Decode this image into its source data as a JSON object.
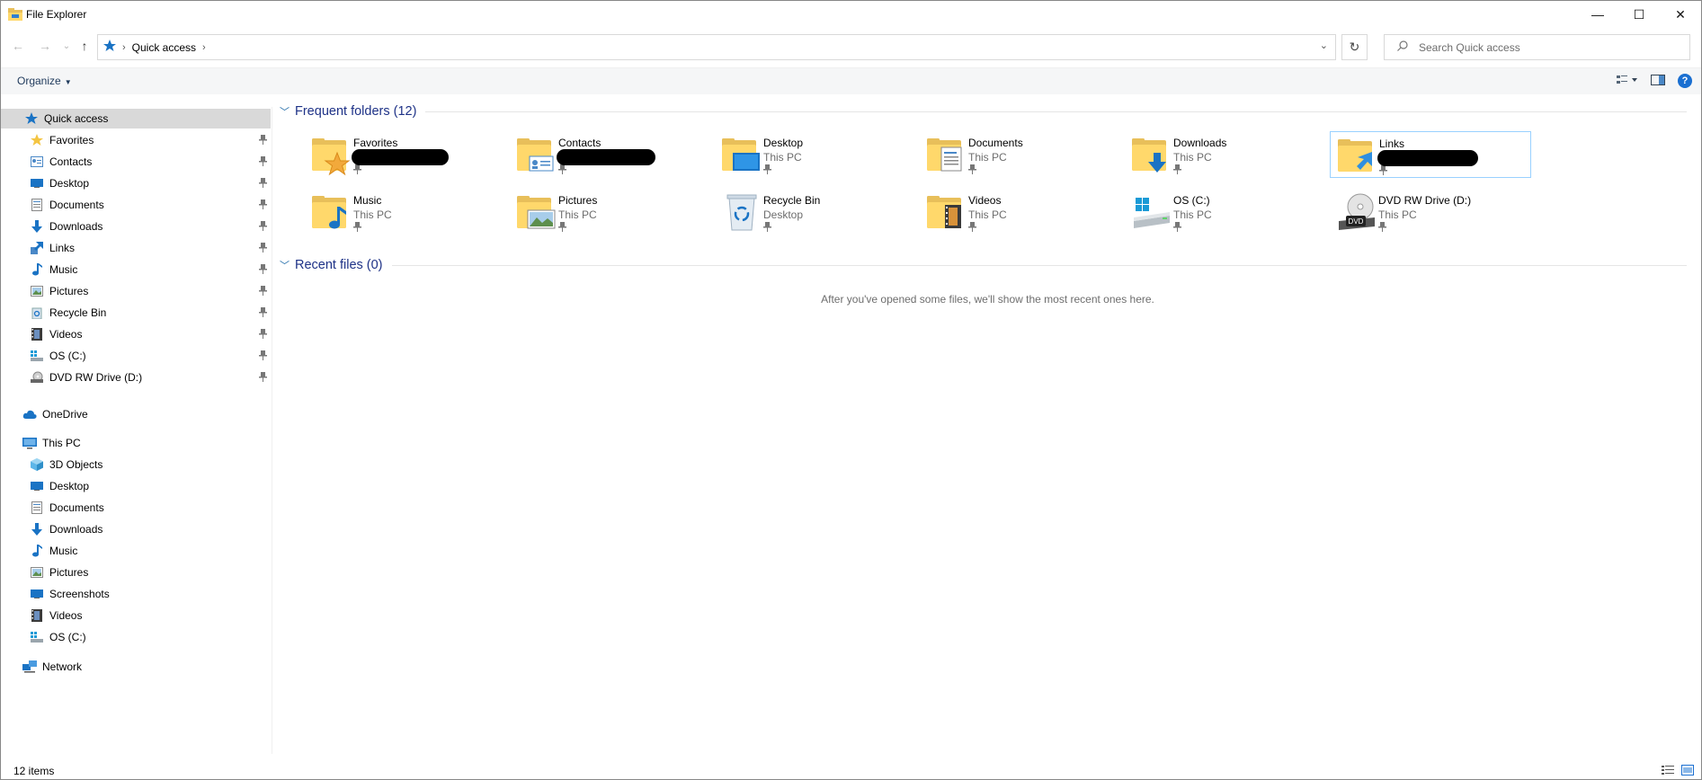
{
  "window": {
    "title": "File Explorer",
    "minimize": "—",
    "maximize": "☐",
    "close": "✕"
  },
  "nav": {
    "back": "←",
    "forward": "→",
    "recent": "⌄",
    "up": "↑"
  },
  "address": {
    "crumb": "Quick access",
    "sep": "›",
    "dropdown": "⌄",
    "refresh": "↻"
  },
  "search": {
    "placeholder": "Search Quick access"
  },
  "commandbar": {
    "organize": "Organize",
    "help": "?"
  },
  "sidebar": {
    "quick_access": "Quick access",
    "quick_items": [
      {
        "label": "Favorites",
        "icon": "star-icon"
      },
      {
        "label": "Contacts",
        "icon": "contacts-icon"
      },
      {
        "label": "Desktop",
        "icon": "desktop-icon"
      },
      {
        "label": "Documents",
        "icon": "documents-icon"
      },
      {
        "label": "Downloads",
        "icon": "downloads-icon"
      },
      {
        "label": "Links",
        "icon": "links-icon"
      },
      {
        "label": "Music",
        "icon": "music-icon"
      },
      {
        "label": "Pictures",
        "icon": "pictures-icon"
      },
      {
        "label": "Recycle Bin",
        "icon": "recycle-bin-icon"
      },
      {
        "label": "Videos",
        "icon": "videos-icon"
      },
      {
        "label": "OS (C:)",
        "icon": "drive-icon"
      },
      {
        "label": "DVD RW Drive (D:)",
        "icon": "dvd-drive-icon"
      }
    ],
    "onedrive": "OneDrive",
    "this_pc": "This PC",
    "pc_items": [
      {
        "label": "3D Objects",
        "icon": "3d-objects-icon"
      },
      {
        "label": "Desktop",
        "icon": "desktop-icon"
      },
      {
        "label": "Documents",
        "icon": "documents-icon"
      },
      {
        "label": "Downloads",
        "icon": "downloads-icon"
      },
      {
        "label": "Music",
        "icon": "music-icon"
      },
      {
        "label": "Pictures",
        "icon": "pictures-icon"
      },
      {
        "label": "Screenshots",
        "icon": "screenshots-icon"
      },
      {
        "label": "Videos",
        "icon": "videos-icon"
      },
      {
        "label": "OS (C:)",
        "icon": "drive-icon"
      }
    ],
    "network": "Network"
  },
  "main": {
    "frequent_title": "Frequent folders (12)",
    "recent_title": "Recent files (0)",
    "empty_message": "After you've opened some files, we'll show the most recent ones here.",
    "folders": [
      {
        "name": "Favorites",
        "location": "",
        "icon": "favorites-folder-icon",
        "redacted": true
      },
      {
        "name": "Contacts",
        "location": "",
        "icon": "contacts-folder-icon",
        "redacted": true
      },
      {
        "name": "Desktop",
        "location": "This PC",
        "icon": "desktop-folder-icon"
      },
      {
        "name": "Documents",
        "location": "This PC",
        "icon": "documents-folder-icon"
      },
      {
        "name": "Downloads",
        "location": "This PC",
        "icon": "downloads-folder-icon"
      },
      {
        "name": "Links",
        "location": "",
        "icon": "links-folder-icon",
        "redacted": true
      },
      {
        "name": "Music",
        "location": "This PC",
        "icon": "music-folder-icon"
      },
      {
        "name": "Pictures",
        "location": "This PC",
        "icon": "pictures-folder-icon"
      },
      {
        "name": "Recycle Bin",
        "location": "Desktop",
        "icon": "recycle-bin-icon"
      },
      {
        "name": "Videos",
        "location": "This PC",
        "icon": "videos-folder-icon"
      },
      {
        "name": "OS (C:)",
        "location": "This PC",
        "icon": "os-drive-icon"
      },
      {
        "name": "DVD RW Drive (D:)",
        "location": "This PC",
        "icon": "dvd-drive-icon"
      }
    ]
  },
  "status": {
    "count": "12 items"
  }
}
